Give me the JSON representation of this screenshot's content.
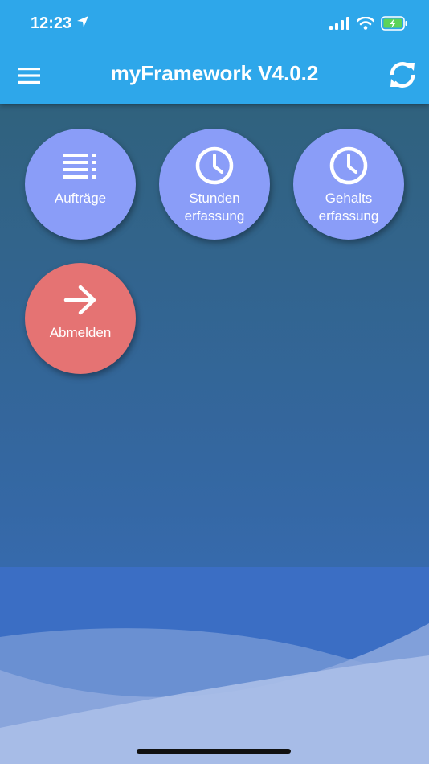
{
  "status_bar": {
    "time": "12:23"
  },
  "header": {
    "title": "myFramework V4.0.2",
    "menu_icon": "hamburger-menu-icon",
    "refresh_icon": "refresh-icon",
    "color": "#2ea7ea"
  },
  "tiles": [
    {
      "label": "Aufträge",
      "icon": "list-icon",
      "color": "#8a9df8"
    },
    {
      "label_line1": "Stunden",
      "label_line2": "erfassung",
      "icon": "clock-icon",
      "color": "#8a9df8"
    },
    {
      "label_line1": "Gehalts",
      "label_line2": "erfassung",
      "icon": "clock-icon",
      "color": "#8a9df8"
    },
    {
      "label": "Abmelden",
      "icon": "arrow-right-icon",
      "color": "#e57373"
    }
  ]
}
